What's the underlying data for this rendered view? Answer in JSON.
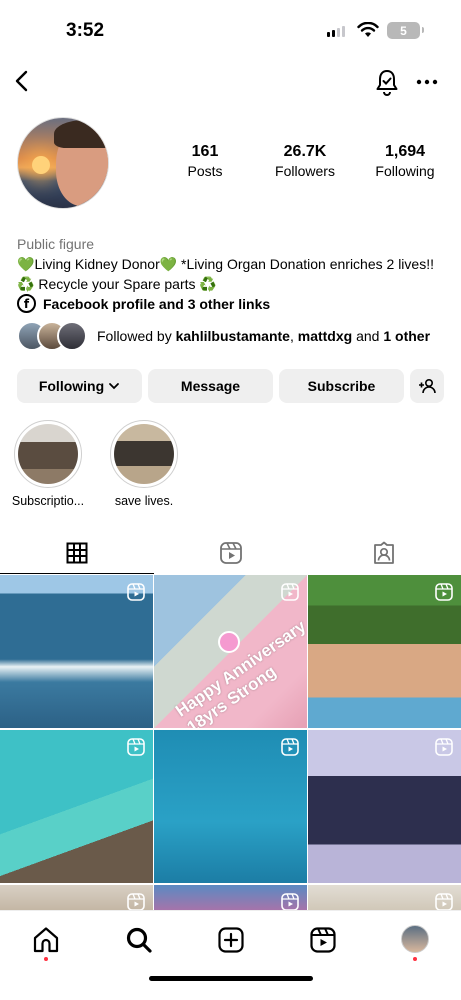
{
  "status_bar": {
    "time": "3:52",
    "battery": "5"
  },
  "profile": {
    "stats": [
      {
        "value": "161",
        "label": "Posts"
      },
      {
        "value": "26.7K",
        "label": "Followers"
      },
      {
        "value": "1,694",
        "label": "Following"
      }
    ],
    "category": "Public figure",
    "bio_line1_heart1": "💚",
    "bio_line1_text1": "Living Kidney Donor",
    "bio_line1_heart2": "💚",
    "bio_line1_text2": " *Living Organ Donation enriches 2 lives!!",
    "bio_line2_icon1": "♻️",
    "bio_line2_text": " Recycle your Spare parts ",
    "bio_line2_icon2": "♻️",
    "links_text": "Facebook profile and 3 other links",
    "followed_prefix": "Followed by ",
    "followed_user1": "kahlilbustamante",
    "followed_sep": ", ",
    "followed_user2": "mattdxg",
    "followed_and": " and ",
    "followed_other": "1 other"
  },
  "actions": {
    "following": "Following",
    "message": "Message",
    "subscribe": "Subscribe"
  },
  "highlights": [
    {
      "label": "Subscriptio..."
    },
    {
      "label": "save lives."
    }
  ],
  "posts": {
    "overlay_text": "Happy Anniversary\n18yrs Strong"
  },
  "icons": {
    "back": "chevron-left-icon",
    "notifications": "bell-icon",
    "more": "more-horizontal-icon",
    "grid": "grid-icon",
    "reels": "reels-icon",
    "tagged": "tagged-icon",
    "home": "home-icon",
    "search": "search-icon",
    "add": "add-icon",
    "profile": "profile-avatar"
  },
  "colors": {
    "accent_dot": "#ff3040",
    "button_bg": "#efefef",
    "muted_text": "#737373"
  }
}
